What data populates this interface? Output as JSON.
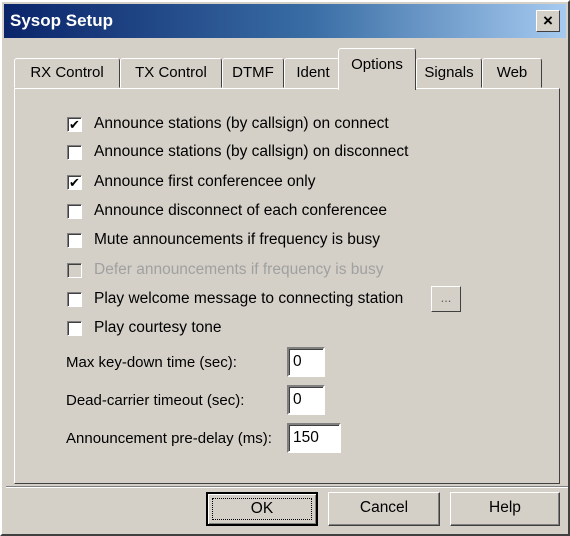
{
  "window": {
    "title": "Sysop Setup",
    "close_glyph": "×"
  },
  "tabs": [
    {
      "label": "RX Control",
      "active": false
    },
    {
      "label": "TX Control",
      "active": false
    },
    {
      "label": "DTMF",
      "active": false
    },
    {
      "label": "Ident",
      "active": false
    },
    {
      "label": "Options",
      "active": true
    },
    {
      "label": "Signals",
      "active": false
    },
    {
      "label": "Web",
      "active": false
    }
  ],
  "options": {
    "checkboxes": [
      {
        "label": "Announce stations (by callsign) on connect",
        "checked": true,
        "enabled": true
      },
      {
        "label": "Announce stations (by callsign) on disconnect",
        "checked": false,
        "enabled": true
      },
      {
        "label": "Announce first conferencee only",
        "checked": true,
        "enabled": true
      },
      {
        "label": "Announce disconnect of each conferencee",
        "checked": false,
        "enabled": true
      },
      {
        "label": "Mute announcements if frequency is busy",
        "checked": false,
        "enabled": true
      },
      {
        "label": "Defer announcements if frequency is busy",
        "checked": false,
        "enabled": false
      },
      {
        "label": "Play welcome message to connecting station",
        "checked": false,
        "enabled": true
      },
      {
        "label": "Play courtesy tone",
        "checked": false,
        "enabled": true
      }
    ],
    "browse_button_label": "...",
    "fields": [
      {
        "label": "Max key-down time (sec):",
        "value": "0"
      },
      {
        "label": "Dead-carrier timeout (sec):",
        "value": "0"
      },
      {
        "label": "Announcement pre-delay (ms):",
        "value": "150"
      }
    ]
  },
  "buttons": {
    "ok": "OK",
    "cancel": "Cancel",
    "help": "Help"
  },
  "check_glyph": "✔"
}
